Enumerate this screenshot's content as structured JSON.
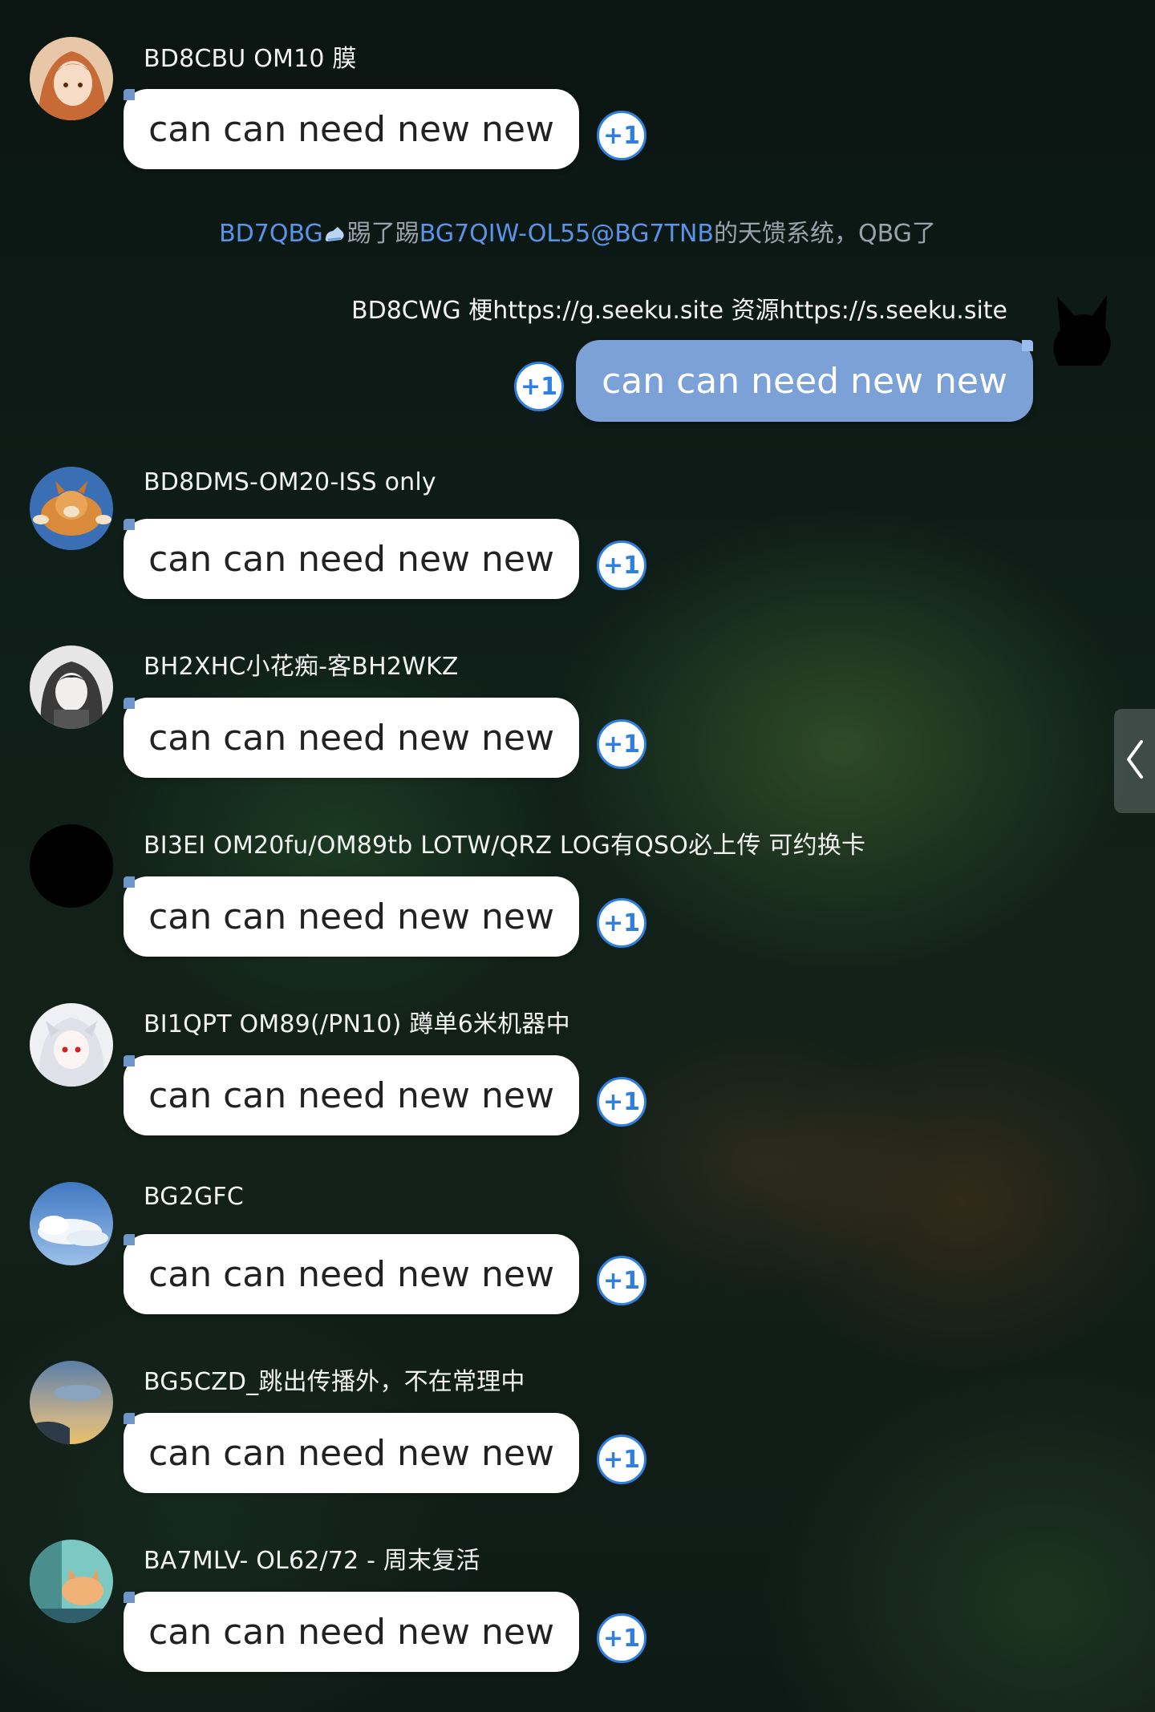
{
  "system_notice": {
    "actor": "BD7QBG",
    "action": "踢了踢",
    "target": "BG7QIW-OL55@BG7TNB",
    "suffix": "的天馈系统，QBG了"
  },
  "self_message": {
    "sender": "BD8CWG 梗https://g.seeku.site  资源https://s.seeku.site",
    "text": "can can need new new",
    "plus_label": "+1"
  },
  "messages": [
    {
      "sender": "BD8CBU OM10 膜",
      "text": "can can need new new",
      "plus_label": "+1"
    },
    {
      "sender": "BD8DMS-OM20-ISS only",
      "text": "can can need new new",
      "plus_label": "+1"
    },
    {
      "sender": "BH2XHC小花痴-客BH2WKZ",
      "text": "can can need new new",
      "plus_label": "+1"
    },
    {
      "sender": "BI3EI OM20fu/OM89tb LOTW/QRZ LOG有QSO必上传 可约换卡",
      "text": "can can need new new",
      "plus_label": "+1"
    },
    {
      "sender": "BI1QPT OM89(/PN10) 蹲单6米机器中",
      "text": "can can need new new",
      "plus_label": "+1"
    },
    {
      "sender": "BG2GFC",
      "text": "can can need new new",
      "plus_label": "+1"
    },
    {
      "sender": "BG5CZD_跳出传播外，不在常理中",
      "text": "can can need new new",
      "plus_label": "+1"
    },
    {
      "sender": "BA7MLV- OL62/72 - 周末复活",
      "text": "can can need new new",
      "plus_label": "+1"
    }
  ],
  "colors": {
    "accent": "#2f7fe0",
    "self_bubble": "#7ba1d6",
    "link": "#5b93e6"
  }
}
